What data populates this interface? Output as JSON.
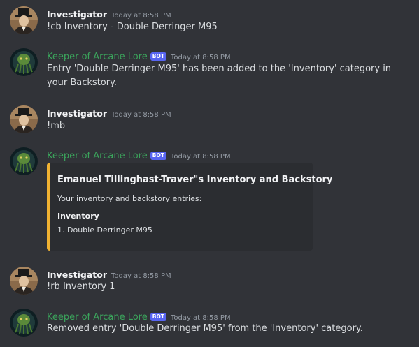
{
  "users": {
    "investigator": "Investigator",
    "keeper": "Keeper of Arcane Lore",
    "bot_tag": "BOT"
  },
  "colors": {
    "background": "#313338",
    "bot_name": "#3ba55c",
    "bot_tag": "#5865f2",
    "embed_accent": "#f0b232",
    "embed_bg": "#2b2d31"
  },
  "icons": {
    "investigator_avatar": "top-hat-man-avatar",
    "keeper_avatar": "tentacled-creature-avatar"
  },
  "messages": [
    {
      "author": "Investigator",
      "time": "Today at 8:58 PM",
      "text": "!cb Inventory - Double Derringer M95"
    },
    {
      "author": "Keeper of Arcane Lore",
      "bot": true,
      "time": "Today at 8:58 PM",
      "text": "Entry 'Double Derringer M95' has been added to the 'Inventory' category in your Backstory."
    },
    {
      "author": "Investigator",
      "time": "Today at 8:58 PM",
      "text": "!mb"
    },
    {
      "author": "Keeper of Arcane Lore",
      "bot": true,
      "time": "Today at 8:58 PM",
      "embed": {
        "title": "Emanuel Tillinghast-Traver\"s Inventory and Backstory",
        "description": "Your inventory and backstory entries:",
        "field_name": "Inventory",
        "field_value": "1. Double Derringer M95"
      }
    },
    {
      "author": "Investigator",
      "time": "Today at 8:58 PM",
      "text": "!rb Inventory 1"
    },
    {
      "author": "Keeper of Arcane Lore",
      "bot": true,
      "time": "Today at 8:58 PM",
      "text": "Removed entry 'Double Derringer M95' from the 'Inventory' category."
    }
  ]
}
